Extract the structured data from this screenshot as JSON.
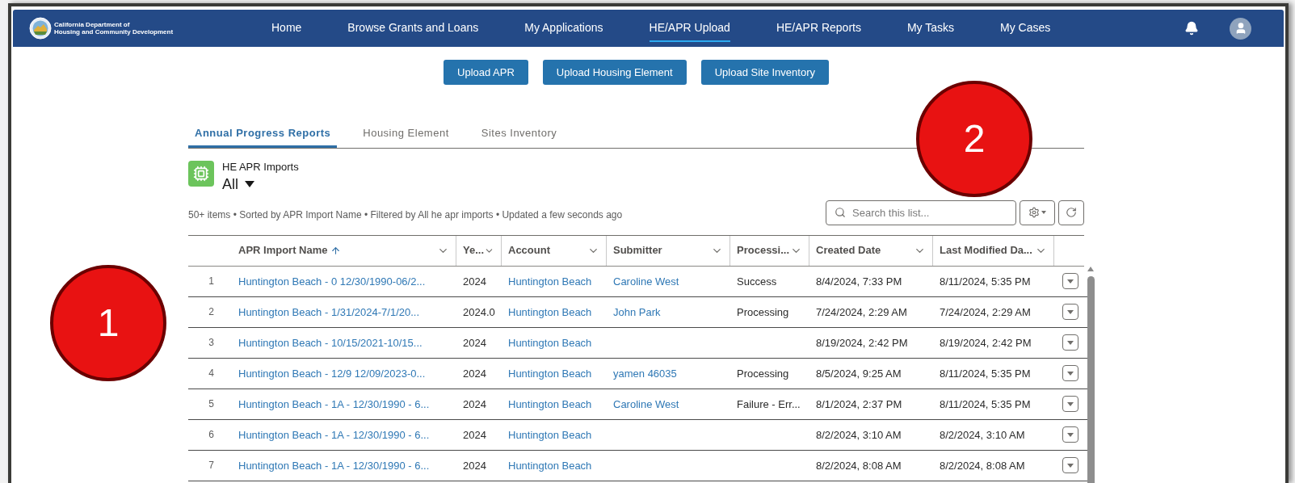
{
  "header": {
    "logo_lines": [
      "California Department of",
      "Housing and Community Development"
    ]
  },
  "nav": [
    {
      "label": "Home",
      "selected": false
    },
    {
      "label": "Browse Grants and Loans",
      "selected": false
    },
    {
      "label": "My Applications",
      "selected": false
    },
    {
      "label": "HE/APR Upload",
      "selected": true
    },
    {
      "label": "HE/APR Reports",
      "selected": false
    },
    {
      "label": "My Tasks",
      "selected": false
    },
    {
      "label": "My Cases",
      "selected": false
    }
  ],
  "upload_buttons": [
    "Upload APR",
    "Upload Housing Element",
    "Upload Site Inventory"
  ],
  "tabs": [
    {
      "label": "Annual Progress Reports",
      "selected": true
    },
    {
      "label": "Housing Element",
      "selected": false
    },
    {
      "label": "Sites Inventory",
      "selected": false
    }
  ],
  "list": {
    "object_label": "HE APR Imports",
    "view": "All",
    "summary": "50+ items • Sorted by APR Import Name • Filtered by All he apr imports • Updated a few seconds ago",
    "search": {
      "placeholder": "Search this list..."
    }
  },
  "table": {
    "columns": [
      {
        "label": "APR Import Name",
        "kind": "link",
        "sorted": true
      },
      {
        "label": "Ye...",
        "kind": "text",
        "sorted": false
      },
      {
        "label": "Account",
        "kind": "link",
        "sorted": false
      },
      {
        "label": "Submitter",
        "kind": "link",
        "sorted": false
      },
      {
        "label": "Processi...",
        "kind": "text",
        "sorted": false
      },
      {
        "label": "Created Date",
        "kind": "text",
        "sorted": false
      },
      {
        "label": "Last Modified Da...",
        "kind": "text",
        "sorted": false
      }
    ],
    "rows": [
      {
        "number": "1",
        "cells": [
          "Huntington Beach - 0 12/30/1990-06/2...",
          "2024",
          "Huntington Beach",
          "Caroline West",
          "Success",
          "8/4/2024, 7:33 PM",
          "8/11/2024, 5:35 PM"
        ]
      },
      {
        "number": "2",
        "cells": [
          "Huntington Beach - 1/31/2024-7/1/20...",
          "2024.0",
          "Huntington Beach",
          "John Park",
          "Processing",
          "7/24/2024, 2:29 AM",
          "7/24/2024, 2:29 AM"
        ]
      },
      {
        "number": "3",
        "cells": [
          "Huntington Beach - 10/15/2021-10/15...",
          "2024",
          "Huntington Beach",
          "",
          "",
          "8/19/2024, 2:42 PM",
          "8/19/2024, 2:42 PM"
        ]
      },
      {
        "number": "4",
        "cells": [
          "Huntington Beach - 12/9 12/09/2023-0...",
          "2024",
          "Huntington Beach",
          "yamen 46035",
          "Processing",
          "8/5/2024, 9:25 AM",
          "8/11/2024, 5:35 PM"
        ]
      },
      {
        "number": "5",
        "cells": [
          "Huntington Beach - 1A - 12/30/1990 - 6...",
          "2024",
          "Huntington Beach",
          "Caroline West",
          "Failure - Err...",
          "8/1/2024, 2:37 PM",
          "8/11/2024, 5:35 PM"
        ]
      },
      {
        "number": "6",
        "cells": [
          "Huntington Beach - 1A - 12/30/1990 - 6...",
          "2024",
          "Huntington Beach",
          "",
          "",
          "8/2/2024, 3:10 AM",
          "8/2/2024, 3:10 AM"
        ]
      },
      {
        "number": "7",
        "cells": [
          "Huntington Beach - 1A - 12/30/1990 - 6...",
          "2024",
          "Huntington Beach",
          "",
          "",
          "8/2/2024, 8:08 AM",
          "8/2/2024, 8:08 AM"
        ]
      }
    ]
  },
  "callouts": [
    {
      "label": "1"
    },
    {
      "label": "2"
    }
  ]
}
